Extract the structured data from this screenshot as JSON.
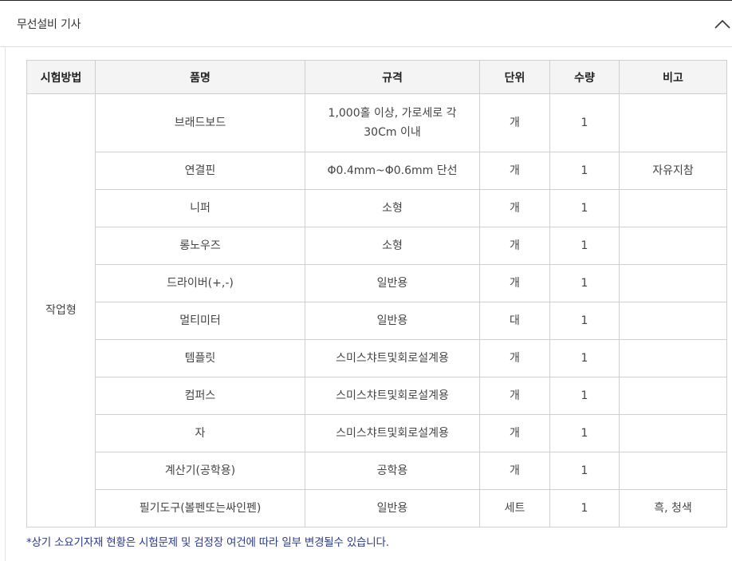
{
  "accordion": {
    "title": "무선설비 기사"
  },
  "table": {
    "headers": [
      "시험방법",
      "품명",
      "규격",
      "단위",
      "수량",
      "비고"
    ],
    "method": "작업형",
    "rows": [
      {
        "name": "브래드보드",
        "spec": "1,000홀 이상, 가로세로 각 30Cm 이내",
        "unit": "개",
        "qty": "1",
        "note": ""
      },
      {
        "name": "연결핀",
        "spec": "Φ0.4mm~Φ0.6mm 단선",
        "unit": "개",
        "qty": "1",
        "note": "자유지참"
      },
      {
        "name": "니퍼",
        "spec": "소형",
        "unit": "개",
        "qty": "1",
        "note": ""
      },
      {
        "name": "롱노우즈",
        "spec": "소형",
        "unit": "개",
        "qty": "1",
        "note": ""
      },
      {
        "name": "드라이버(+,-)",
        "spec": "일반용",
        "unit": "개",
        "qty": "1",
        "note": ""
      },
      {
        "name": "멀티미터",
        "spec": "일반용",
        "unit": "대",
        "qty": "1",
        "note": ""
      },
      {
        "name": "템플릿",
        "spec": "스미스챠트및회로설계용",
        "unit": "개",
        "qty": "1",
        "note": ""
      },
      {
        "name": "컴퍼스",
        "spec": "스미스챠트및회로설계용",
        "unit": "개",
        "qty": "1",
        "note": ""
      },
      {
        "name": "자",
        "spec": "스미스챠트및회로설계용",
        "unit": "개",
        "qty": "1",
        "note": ""
      },
      {
        "name": "계산기(공학용)",
        "spec": "공학용",
        "unit": "개",
        "qty": "1",
        "note": ""
      },
      {
        "name": "필기도구(볼펜또는싸인펜)",
        "spec": "일반용",
        "unit": "세트",
        "qty": "1",
        "note": "흑, 청색"
      }
    ]
  },
  "footnote": "*상기 소요기자재 현황은 시험문제 및 검정장 여건에 따라 일부 변경될수 있습니다.",
  "icons": {
    "toggle": "chevron-up-icon"
  },
  "colors": {
    "footnote": "#2b3a8f",
    "header_bg": "#f4f4f4",
    "border": "#cfcfcf"
  }
}
